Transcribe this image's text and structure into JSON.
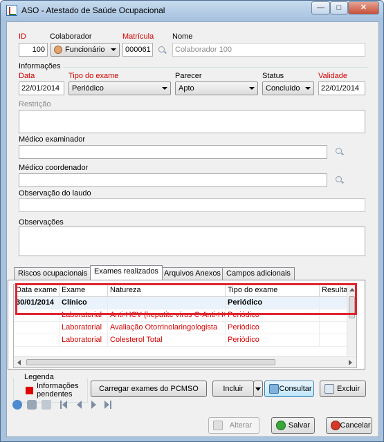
{
  "window": {
    "title": "ASO - Atestado de Saúde Ocupacional",
    "minimize_glyph": "—",
    "maximize_glyph": "□",
    "close_glyph": "✕"
  },
  "header": {
    "id_label": "ID",
    "id_value": "100",
    "colaborador_label": "Colaborador",
    "colaborador_type": "Funcionário",
    "matricula_label": "Matrícula",
    "matricula_value": "000061",
    "nome_label": "Nome",
    "nome_value": "Colaborador 100"
  },
  "informacoes": {
    "group_label": "Informações",
    "data_label": "Data",
    "data_value": "22/01/2014",
    "tipo_label": "Tipo do exame",
    "tipo_value": "Periódico",
    "parecer_label": "Parecer",
    "parecer_value": "Apto",
    "status_label": "Status",
    "status_value": "Concluído",
    "validade_label": "Validade",
    "validade_value": "22/01/2014",
    "restricao_label": "Restrição",
    "medico_examinador_label": "Médico examinador",
    "medico_coordenador_label": "Médico coordenador",
    "observacao_laudo_label": "Observação do laudo",
    "observacoes_label": "Observações"
  },
  "tabs": [
    {
      "label": "Riscos ocupacionais"
    },
    {
      "label": "Exames realizados"
    },
    {
      "label": "Arquivos Anexos"
    },
    {
      "label": "Campos adicionais"
    }
  ],
  "grid": {
    "columns": [
      "Data exame",
      "Exame",
      "Natureza",
      "Tipo do exame",
      "Resulta"
    ],
    "rows": [
      {
        "data": "30/01/2014",
        "exame": "Clínico",
        "natureza": "",
        "tipo": "Periódico",
        "resultado": ""
      },
      {
        "data": "",
        "exame": "Laboratorial",
        "natureza": "Anti-HCV (hepatite vírus C-Anti-HCV)",
        "tipo": "Periódico",
        "resultado": ""
      },
      {
        "data": "",
        "exame": "Laboratorial",
        "natureza": "Avaliação Otorrinolaringologista",
        "tipo": "Periódico",
        "resultado": ""
      },
      {
        "data": "",
        "exame": "Laboratorial",
        "natureza": "Colesterol Total",
        "tipo": "Periódico",
        "resultado": ""
      }
    ]
  },
  "legend": {
    "title": "Legenda",
    "item_label": "Informações pendentes",
    "item_color": "#e00000"
  },
  "actions": {
    "carregar": "Carregar exames do PCMSO",
    "incluir": "Incluir",
    "consultar": "Consultar",
    "excluir": "Excluir",
    "alterar": "Alterar",
    "salvar": "Salvar",
    "cancelar": "Cancelar"
  },
  "colors": {
    "pending_red": "#d40000",
    "highlight_red": "#e0232d"
  }
}
